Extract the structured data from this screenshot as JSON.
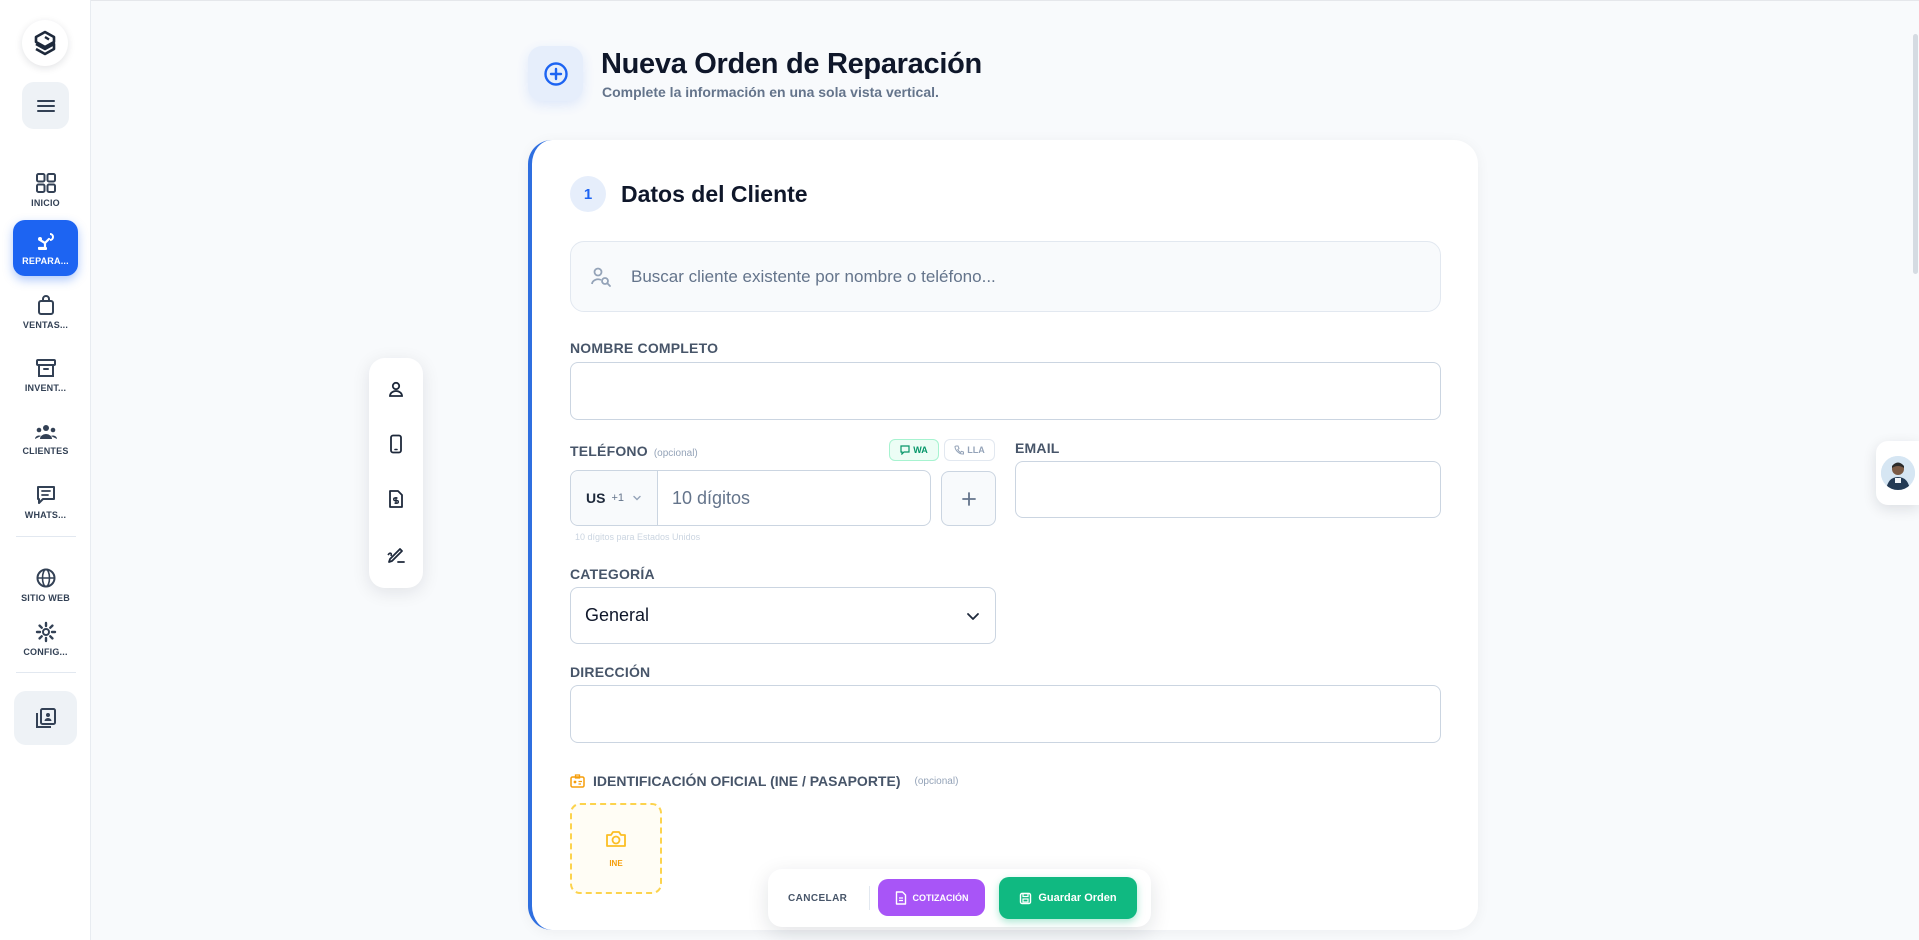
{
  "sidebar": {
    "items": [
      {
        "label": "INICIO",
        "icon": "grid-icon"
      },
      {
        "label": "REPARA...",
        "icon": "repair-robot-icon",
        "active": true
      },
      {
        "label": "VENTAS...",
        "icon": "shopping-bag-icon"
      },
      {
        "label": "INVENT...",
        "icon": "archive-box-icon"
      },
      {
        "label": "CLIENTES",
        "icon": "users-icon"
      },
      {
        "label": "WHATS...",
        "icon": "chat-icon"
      },
      {
        "label": "SITIO WEB",
        "icon": "globe-icon"
      },
      {
        "label": "CONFIG...",
        "icon": "gear-icon"
      }
    ]
  },
  "header": {
    "title": "Nueva Orden de Reparación",
    "subtitle": "Complete la información en una sola vista vertical."
  },
  "section": {
    "number": "1",
    "title": "Datos del Cliente"
  },
  "search": {
    "placeholder": "Buscar cliente existente por nombre o teléfono..."
  },
  "form": {
    "name_label": "NOMBRE COMPLETO",
    "name_value": "",
    "phone_label": "TELÉFONO",
    "phone_optional": "(opcional)",
    "chip_wa": "WA",
    "chip_ll": "LLA",
    "country_code": "US",
    "dial_code": "+1",
    "phone_placeholder": "10 dígitos",
    "phone_hint": "10 dígitos para Estados Unidos",
    "email_label": "EMAIL",
    "email_value": "",
    "category_label": "CATEGORÍA",
    "category_value": "General",
    "address_label": "DIRECCIÓN",
    "address_value": "",
    "id_label": "IDENTIFICACIÓN OFICIAL (INE / PASAPORTE)",
    "id_optional": "(opcional)",
    "upload_label": "INE"
  },
  "actions": {
    "cancel": "CANCELAR",
    "quote": "COTIZACIÓN",
    "save": "Guardar Orden"
  },
  "colors": {
    "primary": "#1d64f2",
    "accent_border": "#2f6fe0",
    "quote": "#a855f7",
    "save": "#10b981",
    "upload_border": "#fcd34d"
  }
}
